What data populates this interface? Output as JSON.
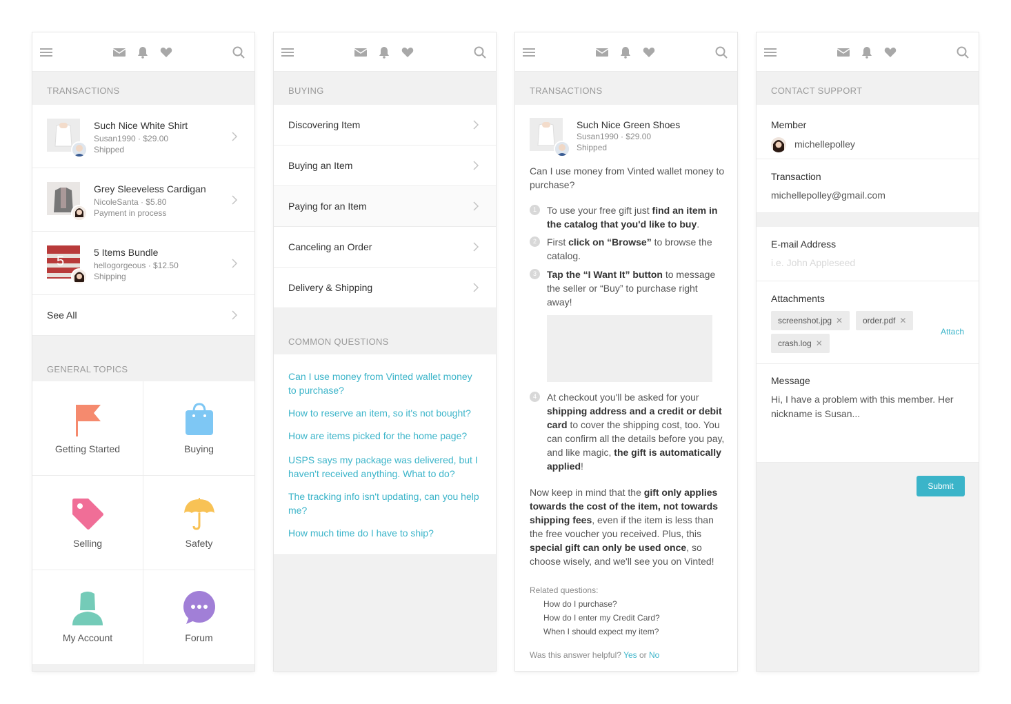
{
  "nav": {
    "menu_icon": "menu-icon",
    "mail_icon": "mail-icon",
    "bell_icon": "bell-icon",
    "heart_icon": "heart-icon",
    "search_icon": "search-icon"
  },
  "colors": {
    "accent": "#3bb4c9",
    "header_text": "#9a9a9a",
    "bg": "#f1f1f1",
    "flag": "#f58a6e",
    "bag": "#7ec7f4",
    "tag": "#f06e97",
    "umbrella": "#f8c255",
    "account": "#74cbb8",
    "forum": "#a17fd7"
  },
  "screen1": {
    "transactions_header": "TRANSACTIONS",
    "transactions": [
      {
        "title": "Such Nice White Shirt",
        "meta": "Susan1990 · $29.00",
        "status": "Shipped"
      },
      {
        "title": "Grey Sleeveless Cardigan",
        "meta": "NicoleSanta · $5.80",
        "status": "Payment in process"
      },
      {
        "title": "5 Items Bundle",
        "meta": "hellogorgeous · $12.50",
        "status": "Shipping",
        "badge": "5"
      }
    ],
    "see_all": "See All",
    "topics_header": "GENERAL TOPICS",
    "topics": [
      {
        "label": "Getting Started",
        "icon": "flag-icon"
      },
      {
        "label": "Buying",
        "icon": "shopping-bag-icon"
      },
      {
        "label": "Selling",
        "icon": "tag-icon"
      },
      {
        "label": "Safety",
        "icon": "umbrella-icon"
      },
      {
        "label": "My Account",
        "icon": "person-icon"
      },
      {
        "label": "Forum",
        "icon": "chat-bubble-icon"
      }
    ]
  },
  "screen2": {
    "buying_header": "BUYING",
    "buying_items": [
      "Discovering Item",
      "Buying an Item",
      "Paying for an Item",
      "Canceling an Order",
      "Delivery & Shipping"
    ],
    "common_header": "COMMON QUESTIONS",
    "questions": [
      "Can I use money from Vinted wallet money to purchase?",
      "How to reserve an item, so it's not bought?",
      "How are items picked for the home page?",
      "USPS says my package was delivered, but I haven't received anything. What to do?",
      "The tracking info isn't updating, can you help me?",
      "How much time do I have to ship?"
    ]
  },
  "screen3": {
    "header": "TRANSACTIONS",
    "item": {
      "title": "Such Nice Green Shoes",
      "meta": "Susan1990 · $29.00",
      "status": "Shipped"
    },
    "question": "Can I use money from Vinted wallet money to purchase?",
    "steps": [
      {
        "n": "1",
        "a": "To use your free gift just ",
        "b": "find an item in the catalog that you'd like to buy",
        "c": "."
      },
      {
        "n": "2",
        "a": "First ",
        "b": "click on “Browse”",
        "c": " to browse the catalog."
      },
      {
        "n": "3",
        "a": "",
        "b": "Tap the “I Want It” button",
        "c": " to message the seller or “Buy” to purchase right away!"
      },
      {
        "n": "4"
      }
    ],
    "step4": {
      "p1": "At checkout you'll be asked for your ",
      "b1": "shipping address and a credit or debit card",
      "p2": " to cover the shipping cost, too. You can confirm all the details before you pay, and like magic, ",
      "b2": "the gift is automatically applied",
      "p3": "!"
    },
    "para": {
      "p1": "Now keep in mind that the ",
      "b1": "gift only applies towards the cost of the item, not towards shipping fees",
      "p2": ", even if the item is less than the free voucher you received. Plus, this ",
      "b2": "special gift can only be used once",
      "p3": ", so choose wisely, and we'll see you on Vinted!"
    },
    "related_label": "Related questions:",
    "related": [
      "How do I purchase?",
      "How do I enter my Credit Card?",
      "When I should expect my item?"
    ],
    "helpful": "Was this answer helpful?",
    "yes": "Yes",
    "or": "or",
    "no": "No"
  },
  "screen4": {
    "header": "CONTACT SUPPORT",
    "member_label": "Member",
    "member_name": "michellepolley",
    "transaction_label": "Transaction",
    "transaction_value": "michellepolley@gmail.com",
    "email_label": "E-mail Address",
    "email_placeholder": "i.e. John Appleseed",
    "attachments_label": "Attachments",
    "attachments": [
      "screenshot.jpg",
      "order.pdf",
      "crash.log"
    ],
    "attach": "Attach",
    "message_label": "Message",
    "message": "Hi, I have a problem with this member. Her nickname is Susan...",
    "submit": "Submit"
  }
}
